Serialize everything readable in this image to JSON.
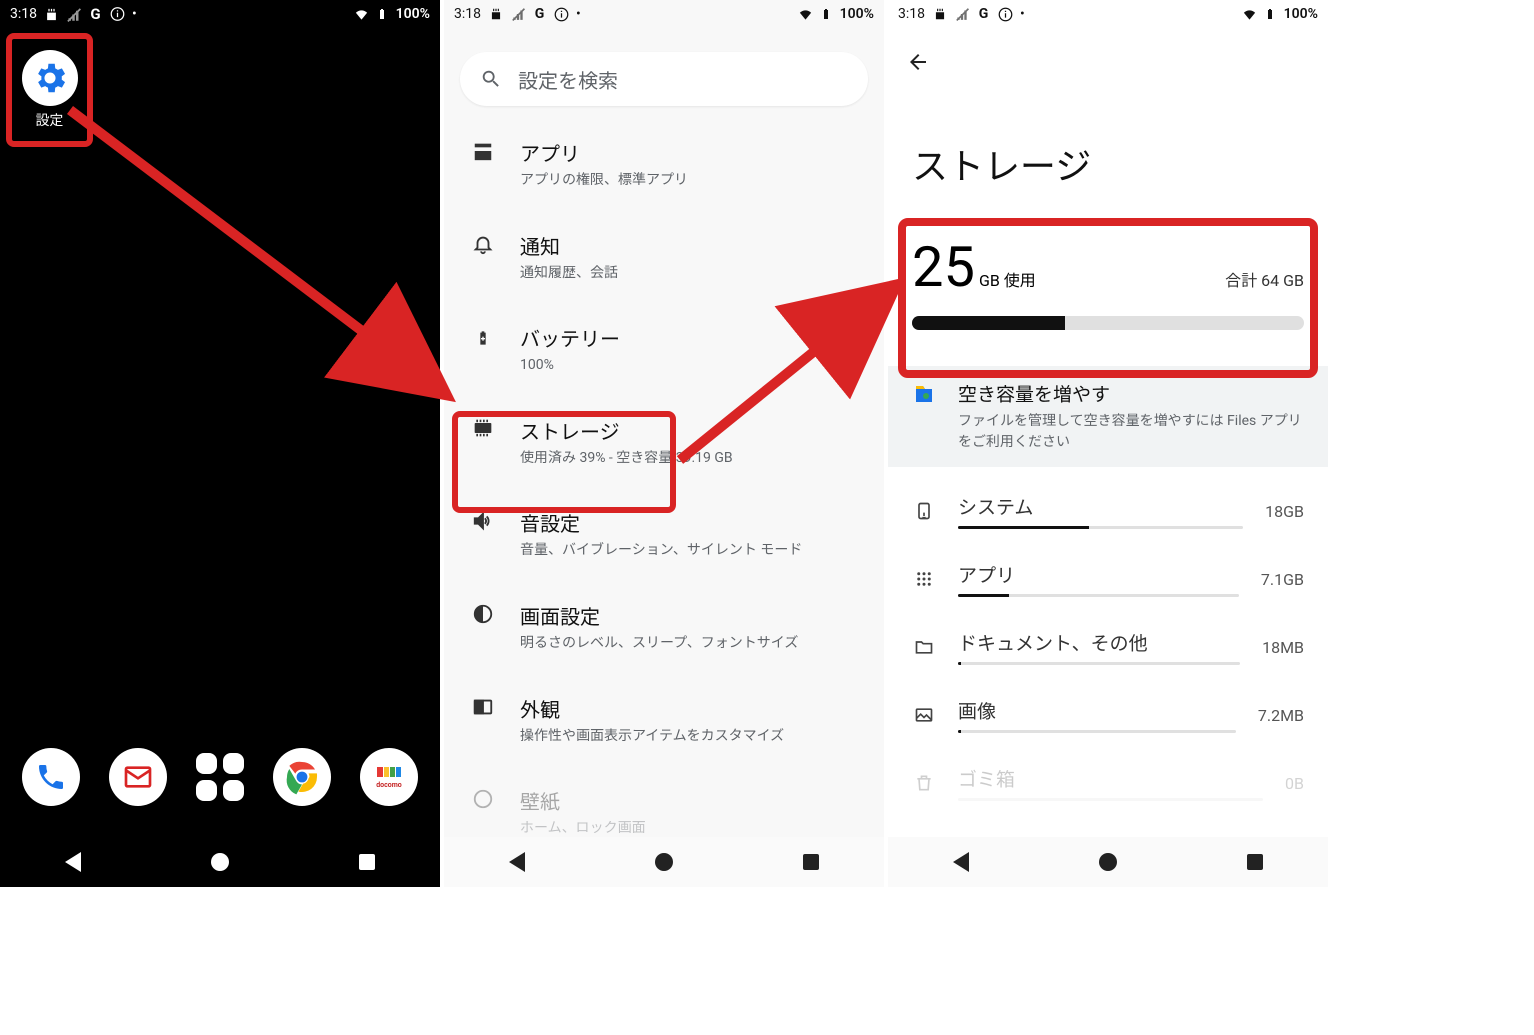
{
  "status": {
    "time": "3:18",
    "battery": "100%"
  },
  "screen1": {
    "settings_label": "設定"
  },
  "screen2": {
    "search_placeholder": "設定を検索",
    "items": [
      {
        "title": "アプリ",
        "sub": "アプリの権限、標準アプリ"
      },
      {
        "title": "通知",
        "sub": "通知履歴、会話"
      },
      {
        "title": "バッテリー",
        "sub": "100%"
      },
      {
        "title": "ストレージ",
        "sub": "使用済み 39% - 空き容量 39.19 GB"
      },
      {
        "title": "音設定",
        "sub": "音量、バイブレーション、サイレント モード"
      },
      {
        "title": "画面設定",
        "sub": "明るさのレベル、スリープ、フォントサイズ"
      },
      {
        "title": "外観",
        "sub": "操作性や画面表示アイテムをカスタマイズ"
      },
      {
        "title": "壁紙",
        "sub": "ホーム、ロック画面"
      }
    ]
  },
  "screen3": {
    "title": "ストレージ",
    "used_value": "25",
    "used_unit": "GB 使用",
    "total_label": "合計 64 GB",
    "used_percent": 39,
    "free_up": {
      "title": "空き容量を増やす",
      "sub": "ファイルを管理して空き容量を増やすには Files アプリをご利用ください"
    },
    "categories": [
      {
        "label": "システム",
        "size": "18GB",
        "pct": 46
      },
      {
        "label": "アプリ",
        "size": "7.1GB",
        "pct": 18
      },
      {
        "label": "ドキュメント、その他",
        "size": "18MB",
        "pct": 1
      },
      {
        "label": "画像",
        "size": "7.2MB",
        "pct": 1
      },
      {
        "label": "ゴミ箱",
        "size": "0B",
        "pct": 0
      }
    ]
  },
  "highlight_color": "#d92424"
}
